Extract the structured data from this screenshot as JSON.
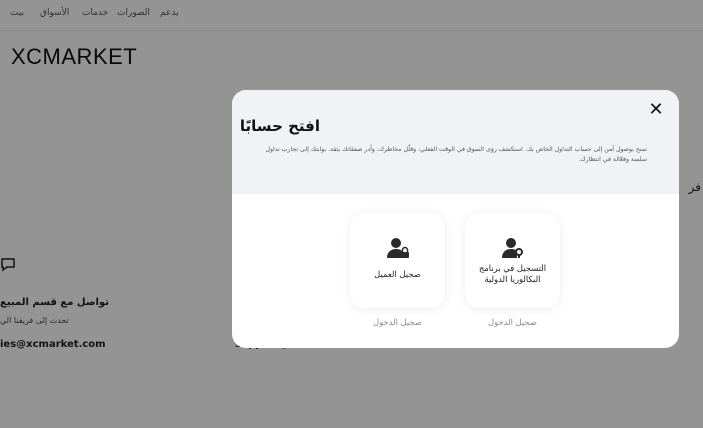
{
  "nav": {
    "items": [
      "يدعم",
      "الصورات",
      "خدمات",
      "الأسواق",
      "بيت"
    ]
  },
  "brand": "XCMARKET",
  "background": {
    "side_letter": "فر",
    "contact_title": "تواصل مع قسم المبيع",
    "contact_sub": "تحدث إلى فريقنا الي",
    "email": "ies@xcmarket.com",
    "email2": "support@xcmarket.com"
  },
  "modal": {
    "title": "افتح حسابًا",
    "description": "تمنح بوصول آمن إلى حساب التداول الخاص بك. استكشف رؤى السوق في الوقت الفعلي، وقلّل مخاطرك، وأدر صفقاتك بثقة. بوابتك إلى تجارب تداول سلسة وفعّالة في انتظارك.",
    "close_label": "✕",
    "options": [
      {
        "label": "التسجيل في برنامج البكالوريا الدولية",
        "login": "صجيل الدخول",
        "icon": "user-key-icon"
      },
      {
        "label": "صجيل العميل",
        "login": "صجيل الدخول",
        "icon": "user-lock-icon"
      }
    ]
  },
  "colors": {
    "overlay": "#6b6b6b",
    "modal_header": "#f0f2f5",
    "card_bg": "#ffffff",
    "muted": "#8b8b8b"
  }
}
